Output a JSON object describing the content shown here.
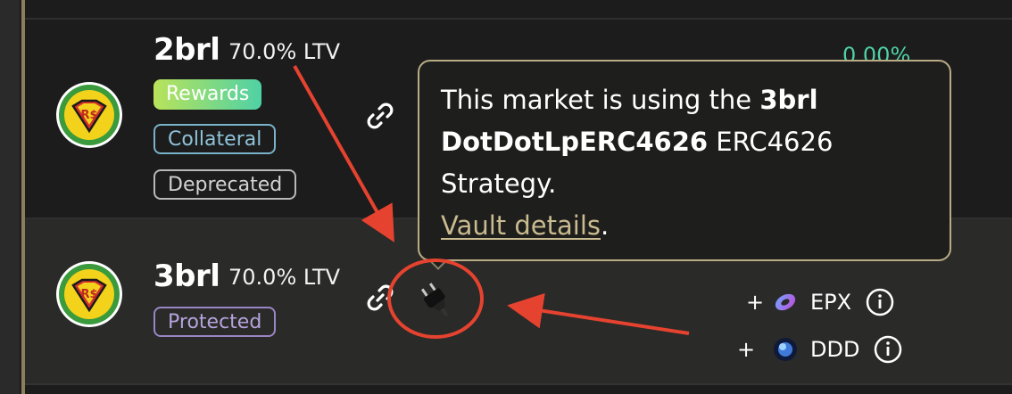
{
  "markets": [
    {
      "name": "2brl",
      "ltv": "70.0% LTV",
      "badges": [
        "Rewards",
        "Collateral",
        "Deprecated"
      ],
      "logo_text": "R$"
    },
    {
      "name": "3brl",
      "ltv": "70.0% LTV",
      "badges": [
        "Protected"
      ],
      "logo_text": "R$",
      "rewards": [
        {
          "plus": "+",
          "symbol": "EPX",
          "icon": "epx-token-icon"
        },
        {
          "plus": "+",
          "symbol": "DDD",
          "icon": "ddd-token-icon"
        }
      ]
    }
  ],
  "tooltip": {
    "prefix": "This market is using the ",
    "strategy_bold": "3brl DotDotLpERC4626",
    "middle": " ERC4626 Strategy.",
    "link": "Vault details",
    "suffix": "."
  },
  "colors": {
    "background": "#1c1c1c",
    "row_highlight": "#2a2a28",
    "tooltip_border": "#b9ac85",
    "link": "#c9bb90",
    "annotation": "#e5432f",
    "rewards_gradient_start": "#b9e35a",
    "rewards_gradient_end": "#4fd1a6"
  }
}
